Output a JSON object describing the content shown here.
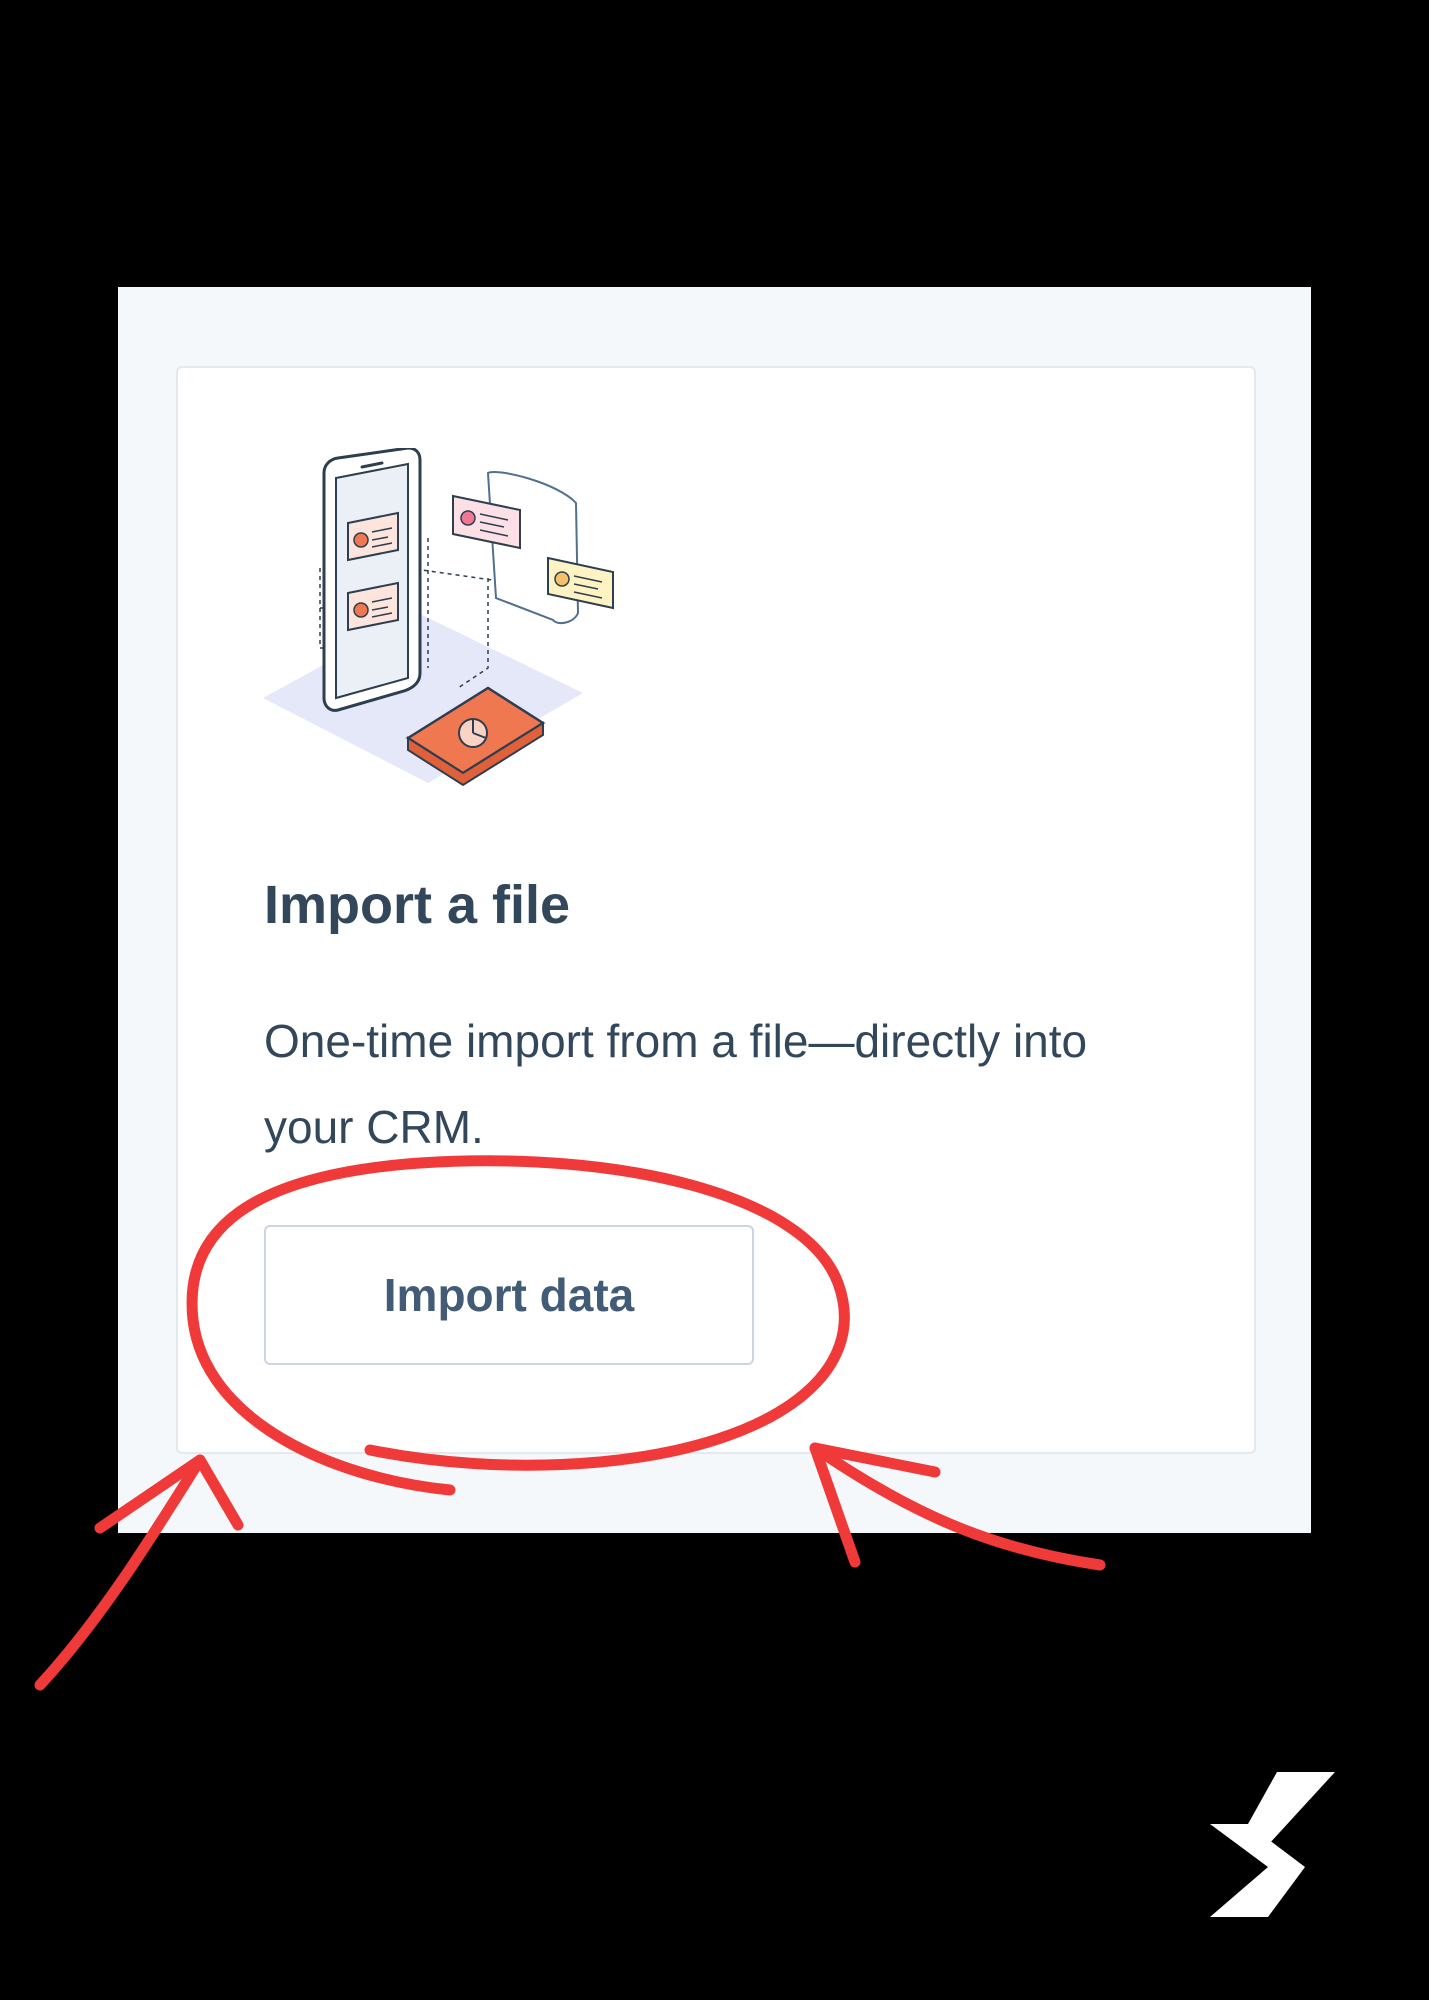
{
  "card": {
    "title": "Import a file",
    "description": "One-time import from a file—directly into your CRM.",
    "button_label": "Import data",
    "illustration_icon": "phone-file-import-illustration"
  },
  "annotation": {
    "circle_color": "#f03a3a",
    "arrow_icon": "hand-drawn-arrow-icon"
  },
  "colors": {
    "text": "#33475b",
    "button_text": "#425b76",
    "panel_bg": "#f5f8fa",
    "accent_orange": "#f07850"
  },
  "logo_icon": "brand-s-logo"
}
